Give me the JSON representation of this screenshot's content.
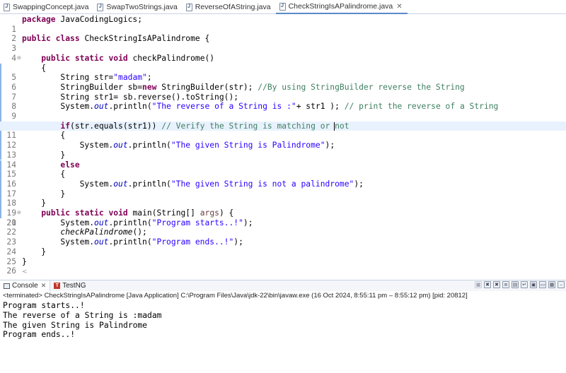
{
  "editor_tabs": [
    {
      "label": "SwappingConcept.java",
      "active": false
    },
    {
      "label": "SwapTwoStrings.java",
      "active": false
    },
    {
      "label": "ReverseOfAString.java",
      "active": false
    },
    {
      "label": "CheckStringIsAPalindrome.java",
      "active": true
    }
  ],
  "tab_close_glyph": "✕",
  "code": {
    "line_numbers": [
      "1",
      "2",
      "3",
      "4",
      "5",
      "6",
      "7",
      "8",
      "9",
      "10",
      "11",
      "12",
      "13",
      "14",
      "15",
      "16",
      "17",
      "18",
      "19",
      "20",
      "21",
      "22",
      "23",
      "24",
      "25",
      "26"
    ],
    "current_line": 12,
    "fold_markers": {
      "5": "⊖",
      "21": "⊖"
    }
  },
  "console": {
    "tabs": [
      {
        "label": "Console",
        "icon": "console-icon"
      },
      {
        "label": "TestNG",
        "icon": "testng-icon"
      }
    ],
    "testng_badge": "T",
    "status": "<terminated> CheckStringIsAPalindrome [Java Application] C:\\Program Files\\Java\\jdk-22\\bin\\javaw.exe  (16 Oct 2024, 8:55:11 pm – 8:55:12 pm) [pid: 20812]",
    "output": [
      "Program starts..!",
      "The reverse of a String is :madam",
      "The given String is Palindrome",
      "Program ends..!"
    ]
  },
  "colors": {
    "keyword": "#7f0055",
    "string": "#2a00ff",
    "comment": "#3f7f5f",
    "field": "#0000c0",
    "current_line_bg": "#e8f2fe"
  }
}
